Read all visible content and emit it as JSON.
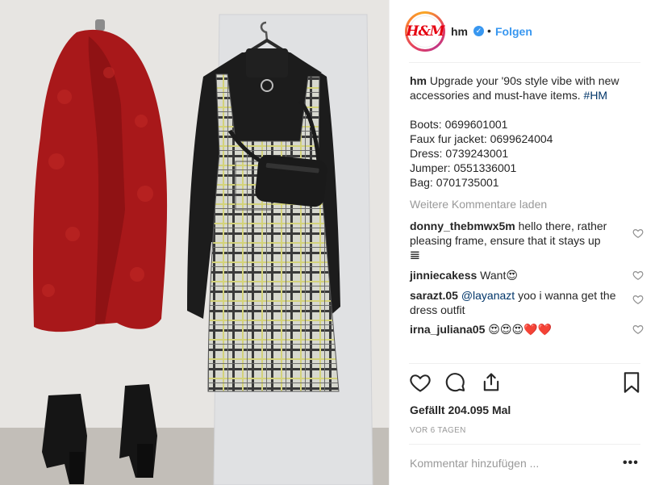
{
  "post": {
    "username": "hm",
    "avatar_text": "H&M",
    "verified_mark": "✓",
    "separator": "•",
    "follow_label": "Folgen",
    "caption_user": "hm",
    "caption_text": "Upgrade your '90s style vibe with new accessories and must-have items. ",
    "caption_tag": "#HM",
    "caption_items": "Boots: 0699601001\nFaux fur jacket: 0699624004\nDress: 0739243001\nJumper: 0551336001\nBag: 0701735001",
    "load_more_label": "Weitere Kommentare laden",
    "comments": [
      {
        "user": "donny_thebmwx5m",
        "mention": "",
        "text": "hello there, rather pleasing frame, ensure that it stays up",
        "trail": "𝌆"
      },
      {
        "user": "jinniecakess",
        "mention": "",
        "text": "Want",
        "trail": "😍"
      },
      {
        "user": "sarazt.05",
        "mention": "@layanazt",
        "text": " yoo i wanna get the dress outfit",
        "trail": ""
      },
      {
        "user": "irna_juliana05",
        "mention": "",
        "text": "",
        "trail": "😍😍😍❤️❤️"
      }
    ],
    "likes_label": "Gefällt 204.095 Mal",
    "time_ago": "VOR 6 TAGEN",
    "add_comment_placeholder": "Kommentar hinzufügen ...",
    "more_label": "•••"
  },
  "icons": {
    "like": "heart-icon",
    "comment": "comment-icon",
    "share": "share-icon",
    "save": "bookmark-icon"
  },
  "colors": {
    "link": "#3897f0",
    "brand_red": "#e50010",
    "text": "#262626",
    "muted": "#999999"
  }
}
